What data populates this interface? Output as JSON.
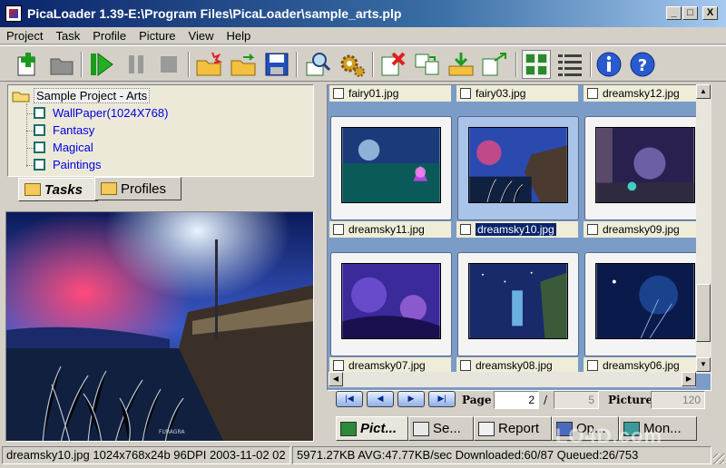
{
  "window": {
    "title": "PicaLoader 1.39-E:\\Program Files\\PicaLoader\\sample_arts.plp",
    "minimize": "_",
    "maximize": "□",
    "close": "X"
  },
  "menu": [
    "Project",
    "Task",
    "Profile",
    "Picture",
    "View",
    "Help"
  ],
  "toolbar": [
    "new-task-icon",
    "open-folder-icon",
    "start-icon",
    "pause-icon",
    "stop-icon",
    "new-folder-icon",
    "open-project-icon",
    "save-icon",
    "search-icon",
    "settings-icon",
    "delete-icon",
    "copy-icon",
    "download-icon",
    "export-icon",
    "thumbnail-view-icon",
    "list-view-icon",
    "info-icon",
    "help-icon"
  ],
  "tree": {
    "root": "Sample Project - Arts",
    "items": [
      "WallPaper(1024X768)",
      "Fantasy",
      "Magical",
      "Paintings"
    ]
  },
  "left_tabs": [
    "Tasks",
    "Profiles"
  ],
  "thumbnails": {
    "top_row": [
      "fairy01.jpg",
      "fairy03.jpg",
      "dreamsky12.jpg"
    ],
    "row1": [
      "dreamsky11.jpg",
      "dreamsky10.jpg",
      "dreamsky09.jpg"
    ],
    "row2": [
      "dreamsky07.jpg",
      "dreamsky08.jpg",
      "dreamsky06.jpg"
    ],
    "selected": "dreamsky10.jpg"
  },
  "nav": {
    "page_label": "Page",
    "page_value": "2",
    "separator": "/",
    "page_total": "5",
    "picture_label": "Picture",
    "picture_total": "120",
    "first": "|◀",
    "prev": "◀",
    "next": "▶",
    "last": "▶|"
  },
  "bottom_tabs": [
    "Pict...",
    "Se...",
    "Report",
    "Op...",
    "Mon..."
  ],
  "status": {
    "file_info": "dreamsky10.jpg 1024x768x24b 96DPI 2003-11-02 02",
    "transfer": "5971.27KB AVG:47.77KB/sec Downloaded:60/87 Queued:26/753"
  },
  "watermark": "LO4D.com",
  "colors": {
    "title_start": "#0a246a",
    "grid_background": "#7b9cc6",
    "selection": "#0a246a",
    "tree_link": "#0000e0"
  }
}
